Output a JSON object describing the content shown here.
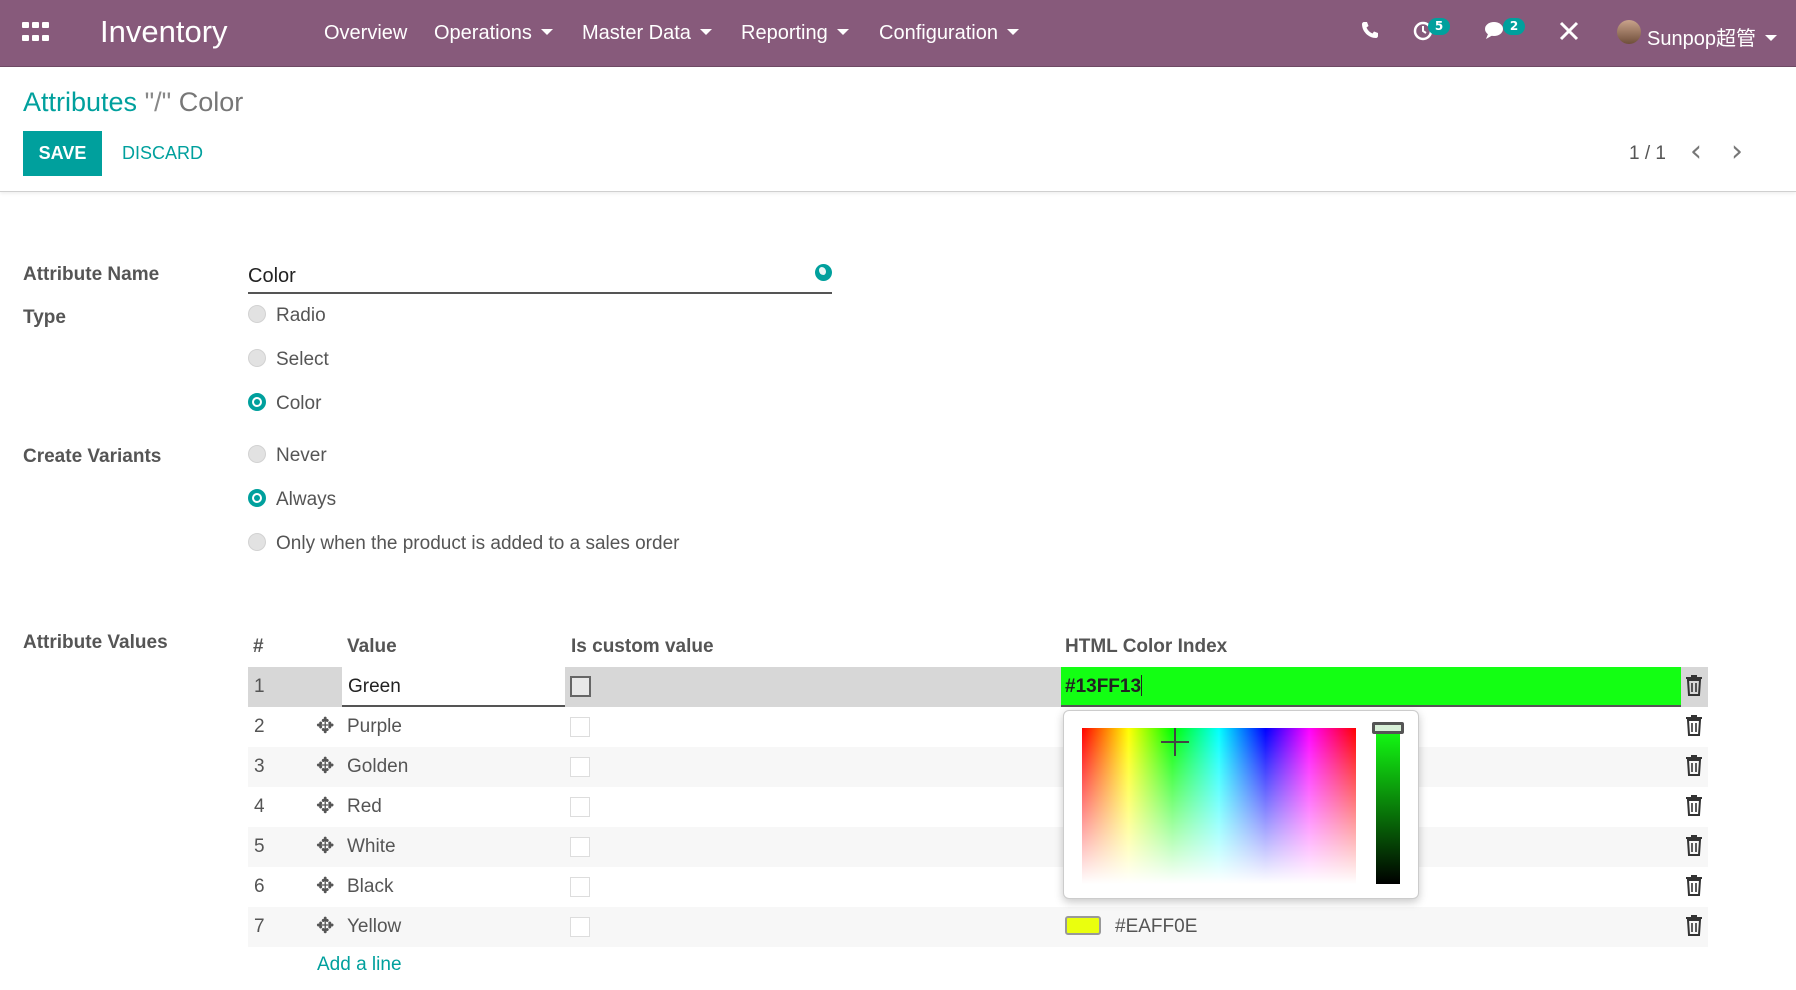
{
  "navbar": {
    "app_name": "Inventory",
    "menus": [
      "Overview",
      "Operations",
      "Master Data",
      "Reporting",
      "Configuration"
    ],
    "activity_count": "5",
    "message_count": "2",
    "user_name": "Sunpop超管"
  },
  "control_panel": {
    "breadcrumb_parent": "Attributes",
    "breadcrumb_sep": " \"/\" ",
    "breadcrumb_current": "Color",
    "save_label": "SAVE",
    "discard_label": "DISCARD",
    "pager": "1 / 1"
  },
  "form": {
    "attribute_name_label": "Attribute Name",
    "attribute_name_value": "Color",
    "type_label": "Type",
    "type_options": [
      "Radio",
      "Select",
      "Color"
    ],
    "type_selected": "Color",
    "create_variants_label": "Create Variants",
    "create_variants_options": [
      "Never",
      "Always",
      "Only when the product is added to a sales order"
    ],
    "create_variants_selected": "Always",
    "attribute_values_label": "Attribute Values"
  },
  "table": {
    "headers": [
      "#",
      "Value",
      "Is custom value",
      "HTML Color Index"
    ],
    "rows": [
      {
        "num": "1",
        "value": "Green",
        "color": "#13FF13",
        "editing": true
      },
      {
        "num": "2",
        "value": "Purple",
        "color": ""
      },
      {
        "num": "3",
        "value": "Golden",
        "color": ""
      },
      {
        "num": "4",
        "value": "Red",
        "color": ""
      },
      {
        "num": "5",
        "value": "White",
        "color": ""
      },
      {
        "num": "6",
        "value": "Black",
        "color": ""
      },
      {
        "num": "7",
        "value": "Yellow",
        "color": "#EAFF0E"
      }
    ],
    "add_line": "Add a line"
  },
  "colors": {
    "brand": "#875a7b",
    "accent": "#00a09d",
    "editing_color": "#13ff13",
    "yellow_swatch": "#eaff0e"
  }
}
